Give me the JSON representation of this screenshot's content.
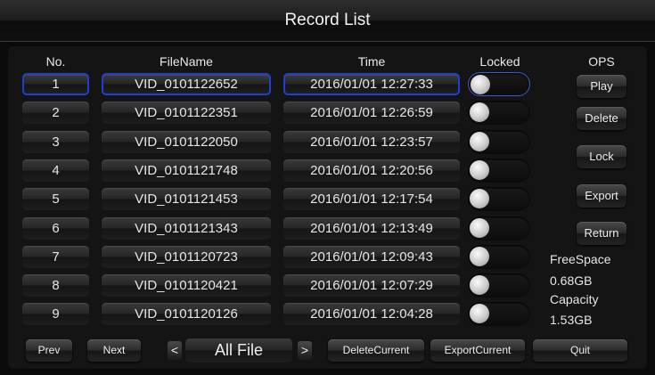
{
  "title": "Record List",
  "columns": {
    "no": "No.",
    "filename": "FileName",
    "time": "Time",
    "locked": "Locked",
    "ops": "OPS"
  },
  "rows": [
    {
      "no": "1",
      "file": "VID_0101122652",
      "time": "2016/01/01 12:27:33",
      "locked": false,
      "selected": true
    },
    {
      "no": "2",
      "file": "VID_0101122351",
      "time": "2016/01/01 12:26:59",
      "locked": false
    },
    {
      "no": "3",
      "file": "VID_0101122050",
      "time": "2016/01/01 12:23:57",
      "locked": false
    },
    {
      "no": "4",
      "file": "VID_0101121748",
      "time": "2016/01/01 12:20:56",
      "locked": false
    },
    {
      "no": "5",
      "file": "VID_0101121453",
      "time": "2016/01/01 12:17:54",
      "locked": false
    },
    {
      "no": "6",
      "file": "VID_0101121343",
      "time": "2016/01/01 12:13:49",
      "locked": false
    },
    {
      "no": "7",
      "file": "VID_0101120723",
      "time": "2016/01/01 12:09:43",
      "locked": false
    },
    {
      "no": "8",
      "file": "VID_0101120421",
      "time": "2016/01/01 12:07:29",
      "locked": false
    },
    {
      "no": "9",
      "file": "VID_0101120126",
      "time": "2016/01/01 12:04:28",
      "locked": false
    }
  ],
  "ops": {
    "play": "Play",
    "delete": "Delete",
    "lock": "Lock",
    "export": "Export",
    "return": "Return"
  },
  "storage": {
    "freespace_label": "FreeSpace",
    "freespace_value": "0.68GB",
    "capacity_label": "Capacity",
    "capacity_value": "1.53GB"
  },
  "bottom": {
    "prev": "Prev",
    "next": "Next",
    "left_arrow": "<",
    "right_arrow": ">",
    "filter": "All File",
    "delete_current": "DeleteCurrent",
    "export_current": "ExportCurrent",
    "quit": "Quit"
  },
  "colors": {
    "selection": "#1f3fd0",
    "background": "#0a0a0a"
  },
  "icons": {
    "left": "chevron-left-icon",
    "right": "chevron-right-icon",
    "knob": "toggle-knob-icon"
  }
}
